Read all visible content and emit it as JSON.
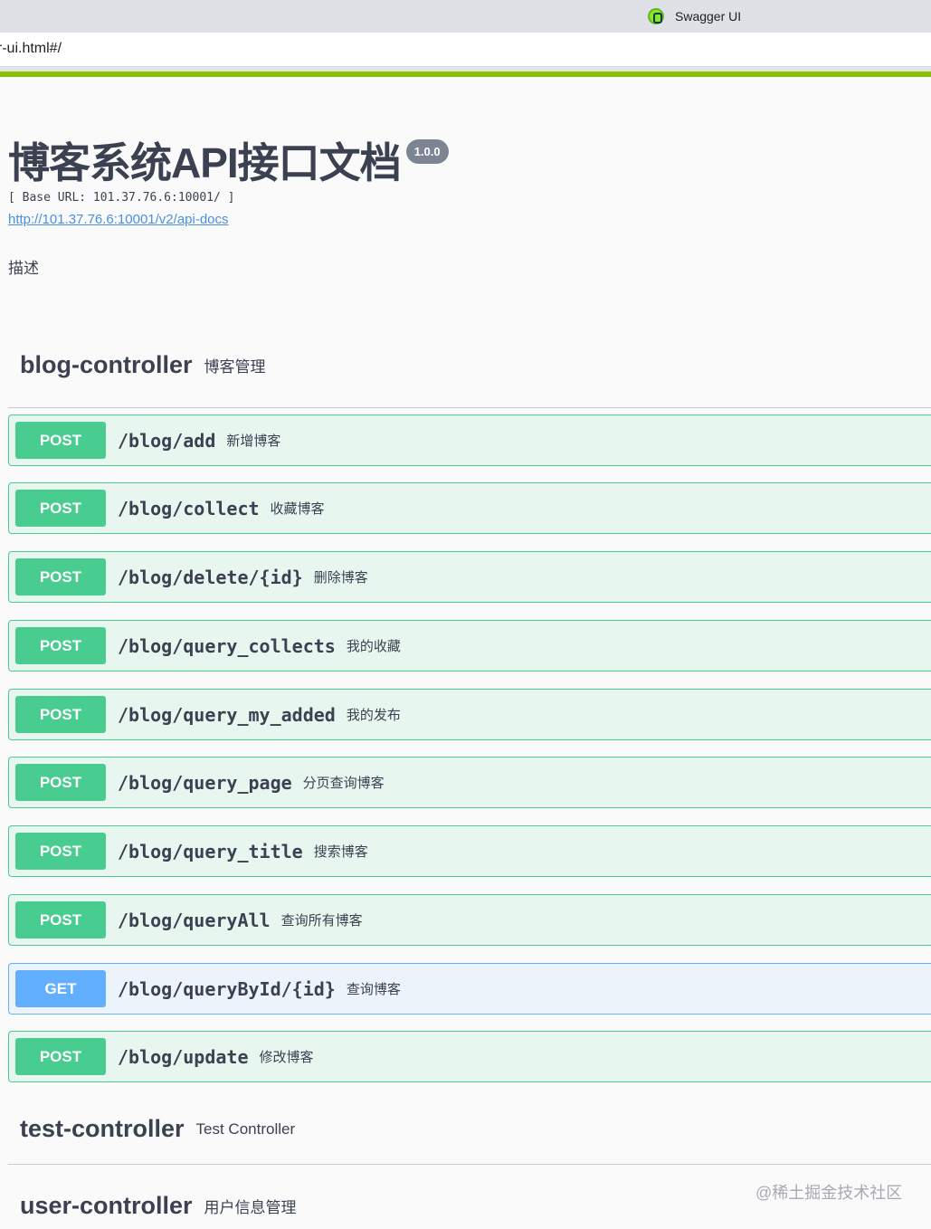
{
  "browser": {
    "tab_title": "Swagger UI",
    "url": "er-ui.html#/"
  },
  "info": {
    "title": "博客系统API接口文档",
    "version": "1.0.0",
    "base_url": "[ Base URL: 101.37.76.6:10001/ ]",
    "docs_link": "http://101.37.76.6:10001/v2/api-docs",
    "description": "描述"
  },
  "tags": [
    {
      "name": "blog-controller",
      "description": "博客管理",
      "operations": [
        {
          "method": "POST",
          "path": "/blog/add",
          "summary": "新增博客"
        },
        {
          "method": "POST",
          "path": "/blog/collect",
          "summary": "收藏博客"
        },
        {
          "method": "POST",
          "path": "/blog/delete/{id}",
          "summary": "删除博客"
        },
        {
          "method": "POST",
          "path": "/blog/query_collects",
          "summary": "我的收藏"
        },
        {
          "method": "POST",
          "path": "/blog/query_my_added",
          "summary": "我的发布"
        },
        {
          "method": "POST",
          "path": "/blog/query_page",
          "summary": "分页查询博客"
        },
        {
          "method": "POST",
          "path": "/blog/query_title",
          "summary": "搜索博客"
        },
        {
          "method": "POST",
          "path": "/blog/queryAll",
          "summary": "查询所有博客"
        },
        {
          "method": "GET",
          "path": "/blog/queryById/{id}",
          "summary": "查询博客"
        },
        {
          "method": "POST",
          "path": "/blog/update",
          "summary": "修改博客"
        }
      ]
    },
    {
      "name": "test-controller",
      "description": "Test Controller"
    },
    {
      "name": "user-controller",
      "description": "用户信息管理"
    }
  ],
  "watermark": "@稀土掘金技术社区",
  "colors": {
    "post": "#49cc90",
    "get": "#61affe",
    "topbar_accent": "#89bf04",
    "link": "#4990e2"
  },
  "icons": {
    "tab_favicon": "swagger-logo-icon"
  }
}
